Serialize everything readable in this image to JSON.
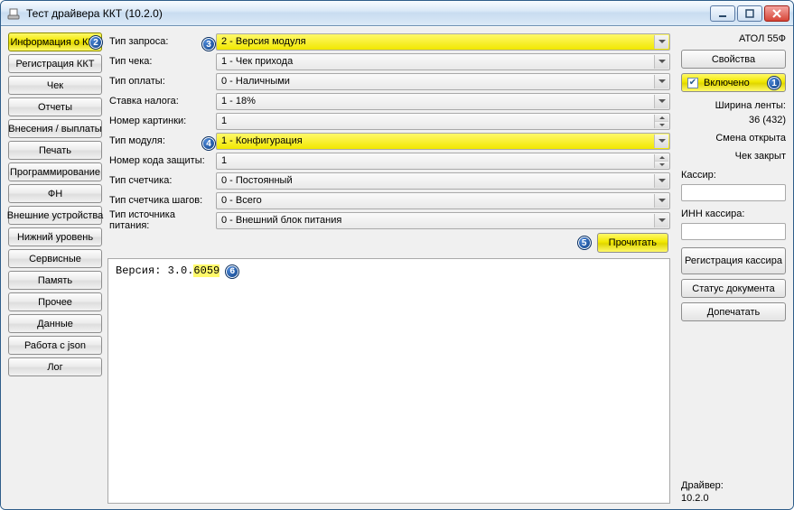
{
  "window": {
    "title": "Тест драйвера ККТ (10.2.0)"
  },
  "sidebar_left": {
    "items": [
      "Информация о ККТ",
      "Регистрация ККТ",
      "Чек",
      "Отчеты",
      "Внесения / выплаты",
      "Печать",
      "Программирование",
      "ФН",
      "Внешние устройства",
      "Нижний уровень",
      "Сервисные",
      "Память",
      "Прочее",
      "Данные",
      "Работа с json",
      "Лог"
    ],
    "active_index": 0
  },
  "form": {
    "rows": [
      {
        "label": "Тип запроса:",
        "value": "2 - Версия модуля",
        "kind": "select",
        "highlight": true,
        "callout": "3"
      },
      {
        "label": "Тип чека:",
        "value": "1 - Чек прихода",
        "kind": "select",
        "highlight": false
      },
      {
        "label": "Тип оплаты:",
        "value": "0 - Наличными",
        "kind": "select",
        "highlight": false
      },
      {
        "label": "Ставка налога:",
        "value": "1 - 18%",
        "kind": "select",
        "highlight": false
      },
      {
        "label": "Номер картинки:",
        "value": "1",
        "kind": "spin",
        "highlight": false
      },
      {
        "label": "Тип модуля:",
        "value": "1 - Конфигурация",
        "kind": "select",
        "highlight": true,
        "callout": "4"
      },
      {
        "label": "Номер кода защиты:",
        "value": "1",
        "kind": "spin",
        "highlight": false
      },
      {
        "label": "Тип счетчика:",
        "value": "0 - Постоянный",
        "kind": "select",
        "highlight": false
      },
      {
        "label": "Тип счетчика шагов:",
        "value": "0 - Всего",
        "kind": "select",
        "highlight": false
      },
      {
        "label": "Тип источника питания:",
        "value": "0 - Внешний блок питания",
        "kind": "select",
        "highlight": false
      }
    ],
    "read_button": "Прочитать"
  },
  "output": {
    "prefix": "Версия: 3.0.",
    "highlight": "6059"
  },
  "right": {
    "model": "АТОЛ 55Ф",
    "properties_btn": "Свойства",
    "enabled_label": "Включено",
    "enabled_checked": true,
    "tape_width_label": "Ширина ленты:",
    "tape_width_value": "36 (432)",
    "shift_status": "Смена открыта",
    "check_status": "Чек закрыт",
    "cashier_label": "Кассир:",
    "cashier_inn_label": "ИНН кассира:",
    "reg_cashier_btn": "Регистрация кассира",
    "doc_status_btn": "Статус документа",
    "finish_print_btn": "Допечатать",
    "driver_label": "Драйвер:",
    "driver_version": "10.2.0"
  },
  "callouts": {
    "enabled": "1",
    "info_btn": "2",
    "read_btn": "5",
    "output": "6"
  }
}
